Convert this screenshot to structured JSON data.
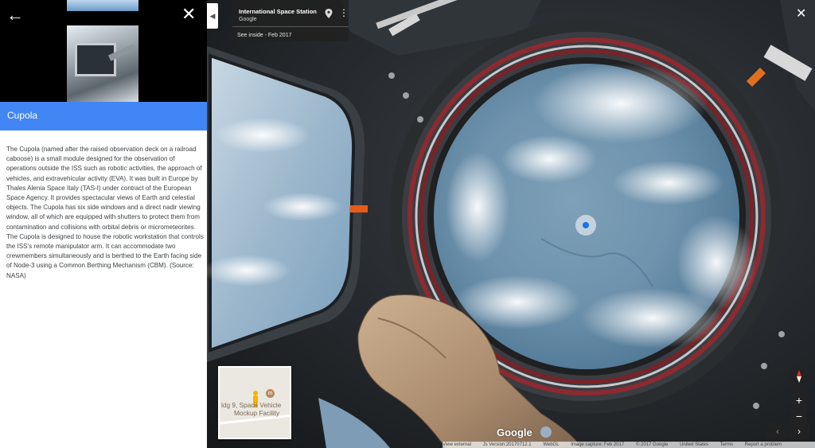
{
  "side_panel": {
    "back_icon": "arrow-left",
    "close_icon": "close",
    "title": "Cupola",
    "title_bar_color": "#4285f4",
    "description": "The Cupola (named after the raised observation deck on a railroad caboose) is a small module designed for the observation of operations outside the ISS such as robotic activities, the approach of vehicles, and extravehicular activity (EVA). It was built in Europe by Thales Alenia Space Italy (TAS-I) under contract of the European Space Agency. It provides spectacular views of Earth and celestial objects. The Cupola has six side windows and a direct nadir viewing window, all of which are equipped with shutters to protect them from contamination and collisions with orbital debris or micrometeorites. The Cupola is designed to house the robotic workstation that controls the ISS's remote manipulator arm. It can accommodate two crewmembers simultaneously and is berthed to the Earth facing side of Node-3 using a Common Berthing Mechanism (CBM). (Source: NASA)"
  },
  "viewer": {
    "collapse_glyph": "◀",
    "info_card": {
      "title": "International Space Station",
      "subtitle": "Google",
      "date_link": "See inside - Feb 2017",
      "pin_icon": "location-pin",
      "more_icon": "more-vertical"
    },
    "close_glyph": "✕",
    "minimap": {
      "label_line1": "ldg 9, Space Vehicle",
      "label_line2": "Mockup Facility",
      "museum_glyph": "m"
    },
    "logo": "Google",
    "footer": {
      "view_external": "View external",
      "js_version": "Js Version:20170712.1",
      "renderer": "WebGL",
      "image_capture": "Image capture: Feb 2017",
      "copyright": "© 2017 Google",
      "region": "United States",
      "terms": "Terms",
      "report": "Report a problem"
    },
    "controls": {
      "zoom_in": "+",
      "zoom_out": "−",
      "prev": "‹",
      "next": "›"
    }
  }
}
